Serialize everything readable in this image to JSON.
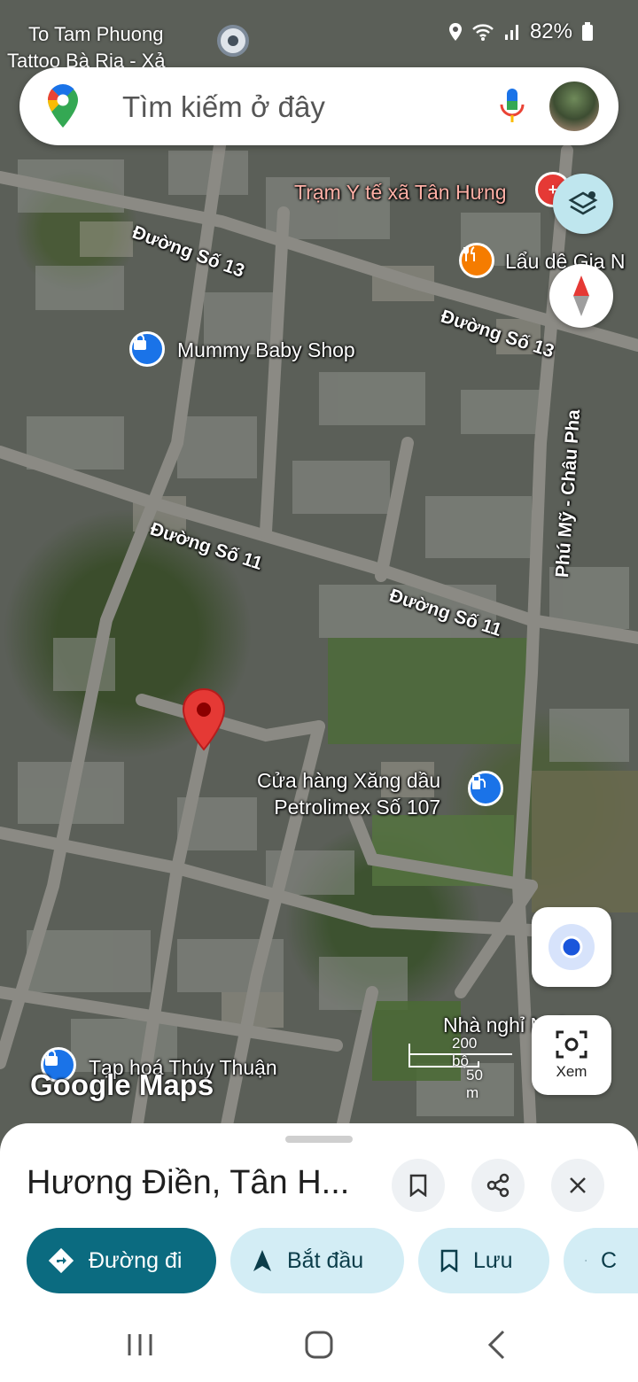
{
  "status_bar": {
    "notification_line1": "To Tam Phuong",
    "notification_line2": "Tattoo Bà Rịa - Xả",
    "battery": "82%"
  },
  "search": {
    "placeholder": "Tìm kiếm ở đây"
  },
  "map": {
    "poi": {
      "clinic": "Trạm Y tế xã Tân Hưng",
      "restaurant": "Lẩu dê Gia N",
      "shop": "Mummy Baby Shop",
      "gas_station_line1": "Cửa hàng Xăng dầu",
      "gas_station_line2": "Petrolimex Số 107",
      "guesthouse": "Nhà nghỉ Ngân",
      "grocery": "Tạp hoá Thúy Thuận"
    },
    "roads": {
      "road13_west": "Đường Số 13",
      "road13_east": "Đường Số 13",
      "road11_west": "Đường Số 11",
      "road11_east": "Đường Số 11",
      "main_road": "Phú Mỹ - Châu Pha"
    },
    "scale_ft": "200 bộ",
    "scale_m": "50 m",
    "watermark": "Google Maps",
    "view_button_label": "Xem"
  },
  "sheet": {
    "title": "Hương Điền, Tân H...",
    "chips": {
      "directions": "Đường đi",
      "start": "Bắt đầu",
      "save": "Lưu",
      "share": "C"
    }
  },
  "colors": {
    "primary_chip": "#0b6b80",
    "secondary_chip": "#d3edf5",
    "pin_red": "#e53935",
    "poi_blue": "#1a73e8",
    "poi_orange": "#f57c00"
  }
}
